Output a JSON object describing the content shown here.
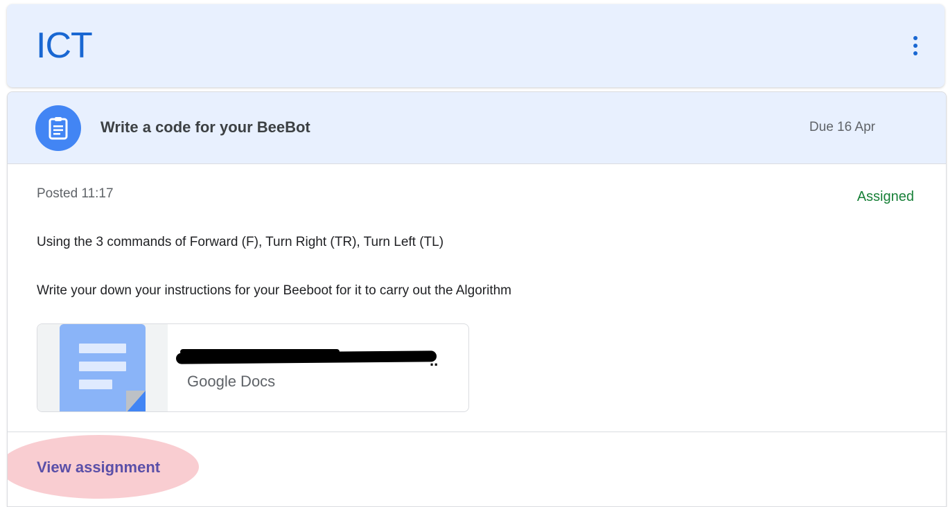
{
  "class_header": {
    "title": "ICT",
    "more_icon": "more-vert-icon"
  },
  "assignment": {
    "icon": "assignment-icon",
    "title": "Write a code for your BeeBot",
    "due": "Due 16 Apr",
    "posted": "Posted 11:17",
    "status": "Assigned",
    "description": [
      "Using the 3 commands of Forward (F), Turn Right (TR), Turn Left (TL)",
      "Write your down your instructions for your Beeboot for it to carry out the Algorithm"
    ],
    "attachment": {
      "name_redacted": "..",
      "type": "Google Docs",
      "icon": "google-docs-icon"
    },
    "view_label": "View assignment"
  },
  "colors": {
    "accent": "#1967d2",
    "header_bg": "#e8f0fe",
    "icon_circle": "#4285f4",
    "status_green": "#188038",
    "highlight": "#f8c8cc"
  }
}
